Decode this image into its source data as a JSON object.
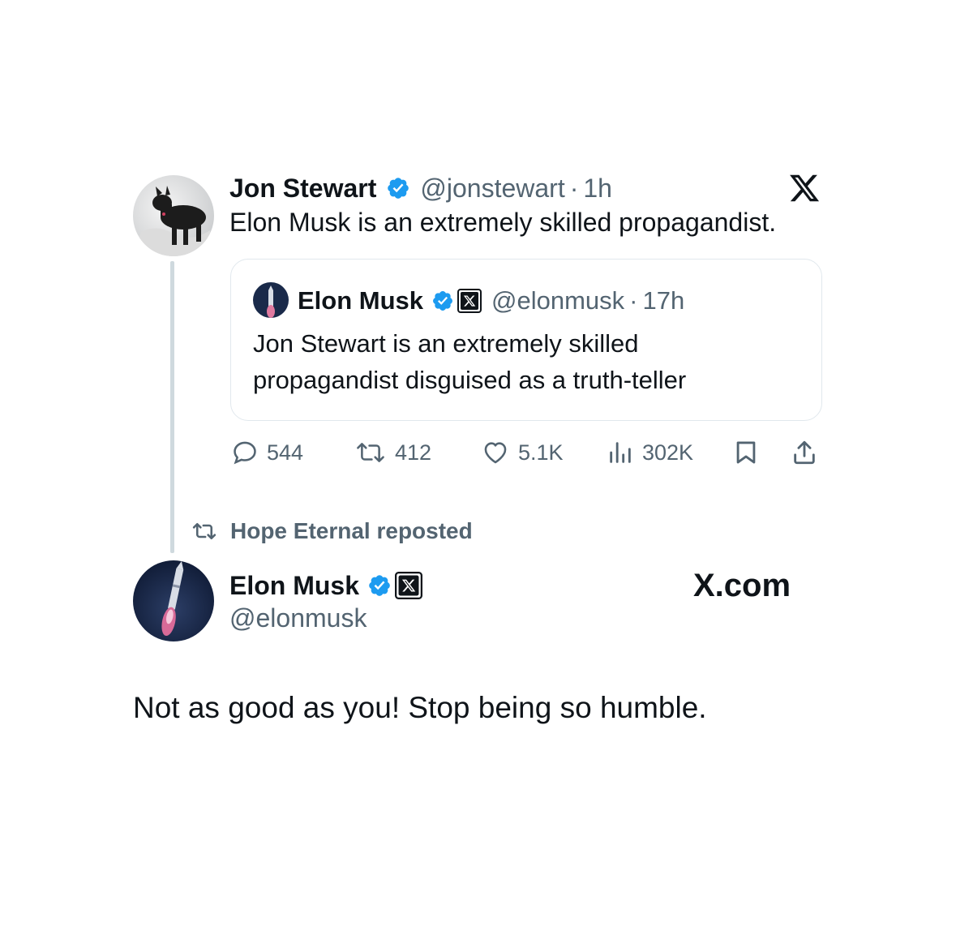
{
  "tweet": {
    "author_name": "Jon Stewart",
    "author_handle": "@jonstewart",
    "separator": "·",
    "time": "1h",
    "text": "Elon Musk is an extremely skilled propagandist.",
    "quote": {
      "author_name": "Elon Musk",
      "author_handle": "@elonmusk",
      "separator": "·",
      "time": "17h",
      "text_line1": "Jon Stewart is an extremely skilled",
      "text_line2": "propagandist disguised as a truth-teller"
    },
    "actions": {
      "replies": "544",
      "reposts": "412",
      "likes": "5.1K",
      "views": "302K"
    }
  },
  "repost_banner": {
    "text": "Hope Eternal reposted"
  },
  "reply": {
    "author_name": "Elon Musk",
    "author_handle": "@elonmusk",
    "brand": "X.com",
    "text": "Not as good as you! Stop being so humble."
  },
  "colors": {
    "verified": "#1d9bf0",
    "muted": "#536471",
    "thread_line": "#cfd9de"
  },
  "icons": [
    "x-logo-icon",
    "verified-icon",
    "x-affiliate-badge-icon",
    "reply-icon",
    "repost-icon",
    "like-icon",
    "views-icon",
    "bookmark-icon",
    "share-icon"
  ]
}
